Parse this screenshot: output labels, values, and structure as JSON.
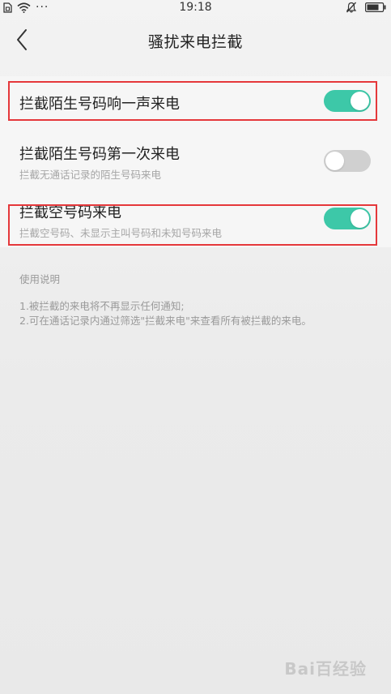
{
  "status_bar": {
    "time": "19:18",
    "dots": "···"
  },
  "header": {
    "title": "骚扰来电拦截",
    "back_icon": "chevron-left-icon"
  },
  "settings": [
    {
      "title": "拦截陌生号码响一声来电",
      "subtitle": "",
      "enabled": true
    },
    {
      "title": "拦截陌生号码第一次来电",
      "subtitle": "拦截无通话记录的陌生号码来电",
      "enabled": false
    },
    {
      "title": "拦截空号码来电",
      "subtitle": "拦截空号码、未显示主叫号码和未知号码来电",
      "enabled": true
    }
  ],
  "instructions": {
    "title": "使用说明",
    "lines": [
      "1.被拦截的来电将不再显示任何通知;",
      "2.可在通话记录内通过筛选\"拦截来电\"来查看所有被拦截的来电。"
    ]
  },
  "watermark": "Bai百经验",
  "colors": {
    "toggle_on": "#3dc8a8",
    "toggle_off": "#d0d0d0",
    "highlight": "#e5383b"
  }
}
